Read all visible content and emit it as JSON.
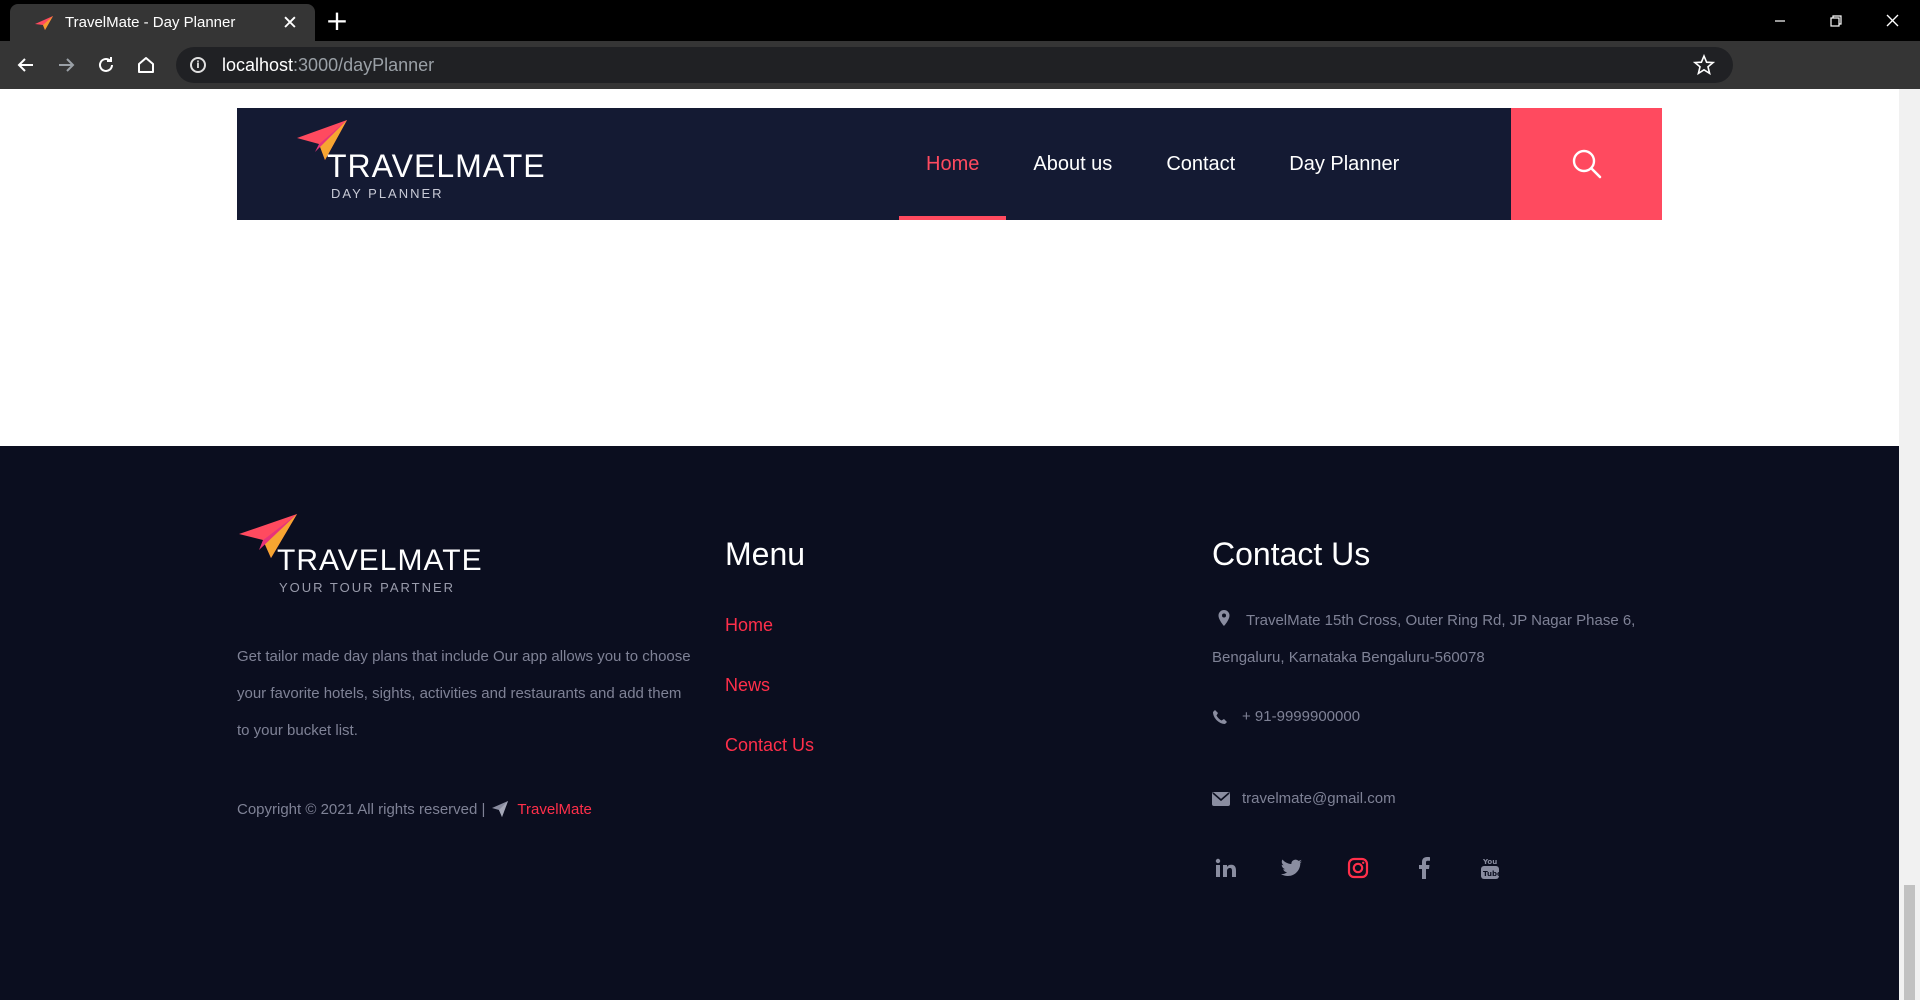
{
  "browser": {
    "tab_title": "TravelMate - Day Planner",
    "url_host": "localhost",
    "url_path": ":3000/dayPlanner"
  },
  "header": {
    "logo_title": "TRAVELMATE",
    "logo_subtitle": "DAY PLANNER",
    "nav": [
      {
        "label": "Home"
      },
      {
        "label": "About us"
      },
      {
        "label": "Contact"
      },
      {
        "label": "Day Planner"
      }
    ],
    "active_nav": "Home"
  },
  "footer": {
    "logo_title": "TRAVELMATE",
    "logo_subtitle": "YOUR TOUR PARTNER",
    "about": "Get tailor made day plans that include Our app allows you to choose your favorite hotels, sights, activities and restaurants and add them to your bucket list.",
    "copyright": "Copyright © 2021 All rights reserved |",
    "copyright_brand": "TravelMate",
    "menu_heading": "Menu",
    "menu": [
      {
        "label": "Home"
      },
      {
        "label": "News"
      },
      {
        "label": "Contact Us"
      }
    ],
    "contact_heading": "Contact Us",
    "address": "TravelMate 15th Cross, Outer Ring Rd, JP Nagar Phase 6, Bengaluru, Karnataka Bengaluru-560078",
    "phone": "+ 91-9999900000",
    "email": "travelmate@gmail.com",
    "socials": [
      "linkedin-icon",
      "twitter-icon",
      "instagram-icon",
      "facebook-icon",
      "youtube-icon"
    ]
  },
  "colors": {
    "header_bg": "#141a33",
    "footer_bg": "#0b0e1f",
    "accent": "#ff4a5f",
    "link_red": "#ff2f4a"
  }
}
